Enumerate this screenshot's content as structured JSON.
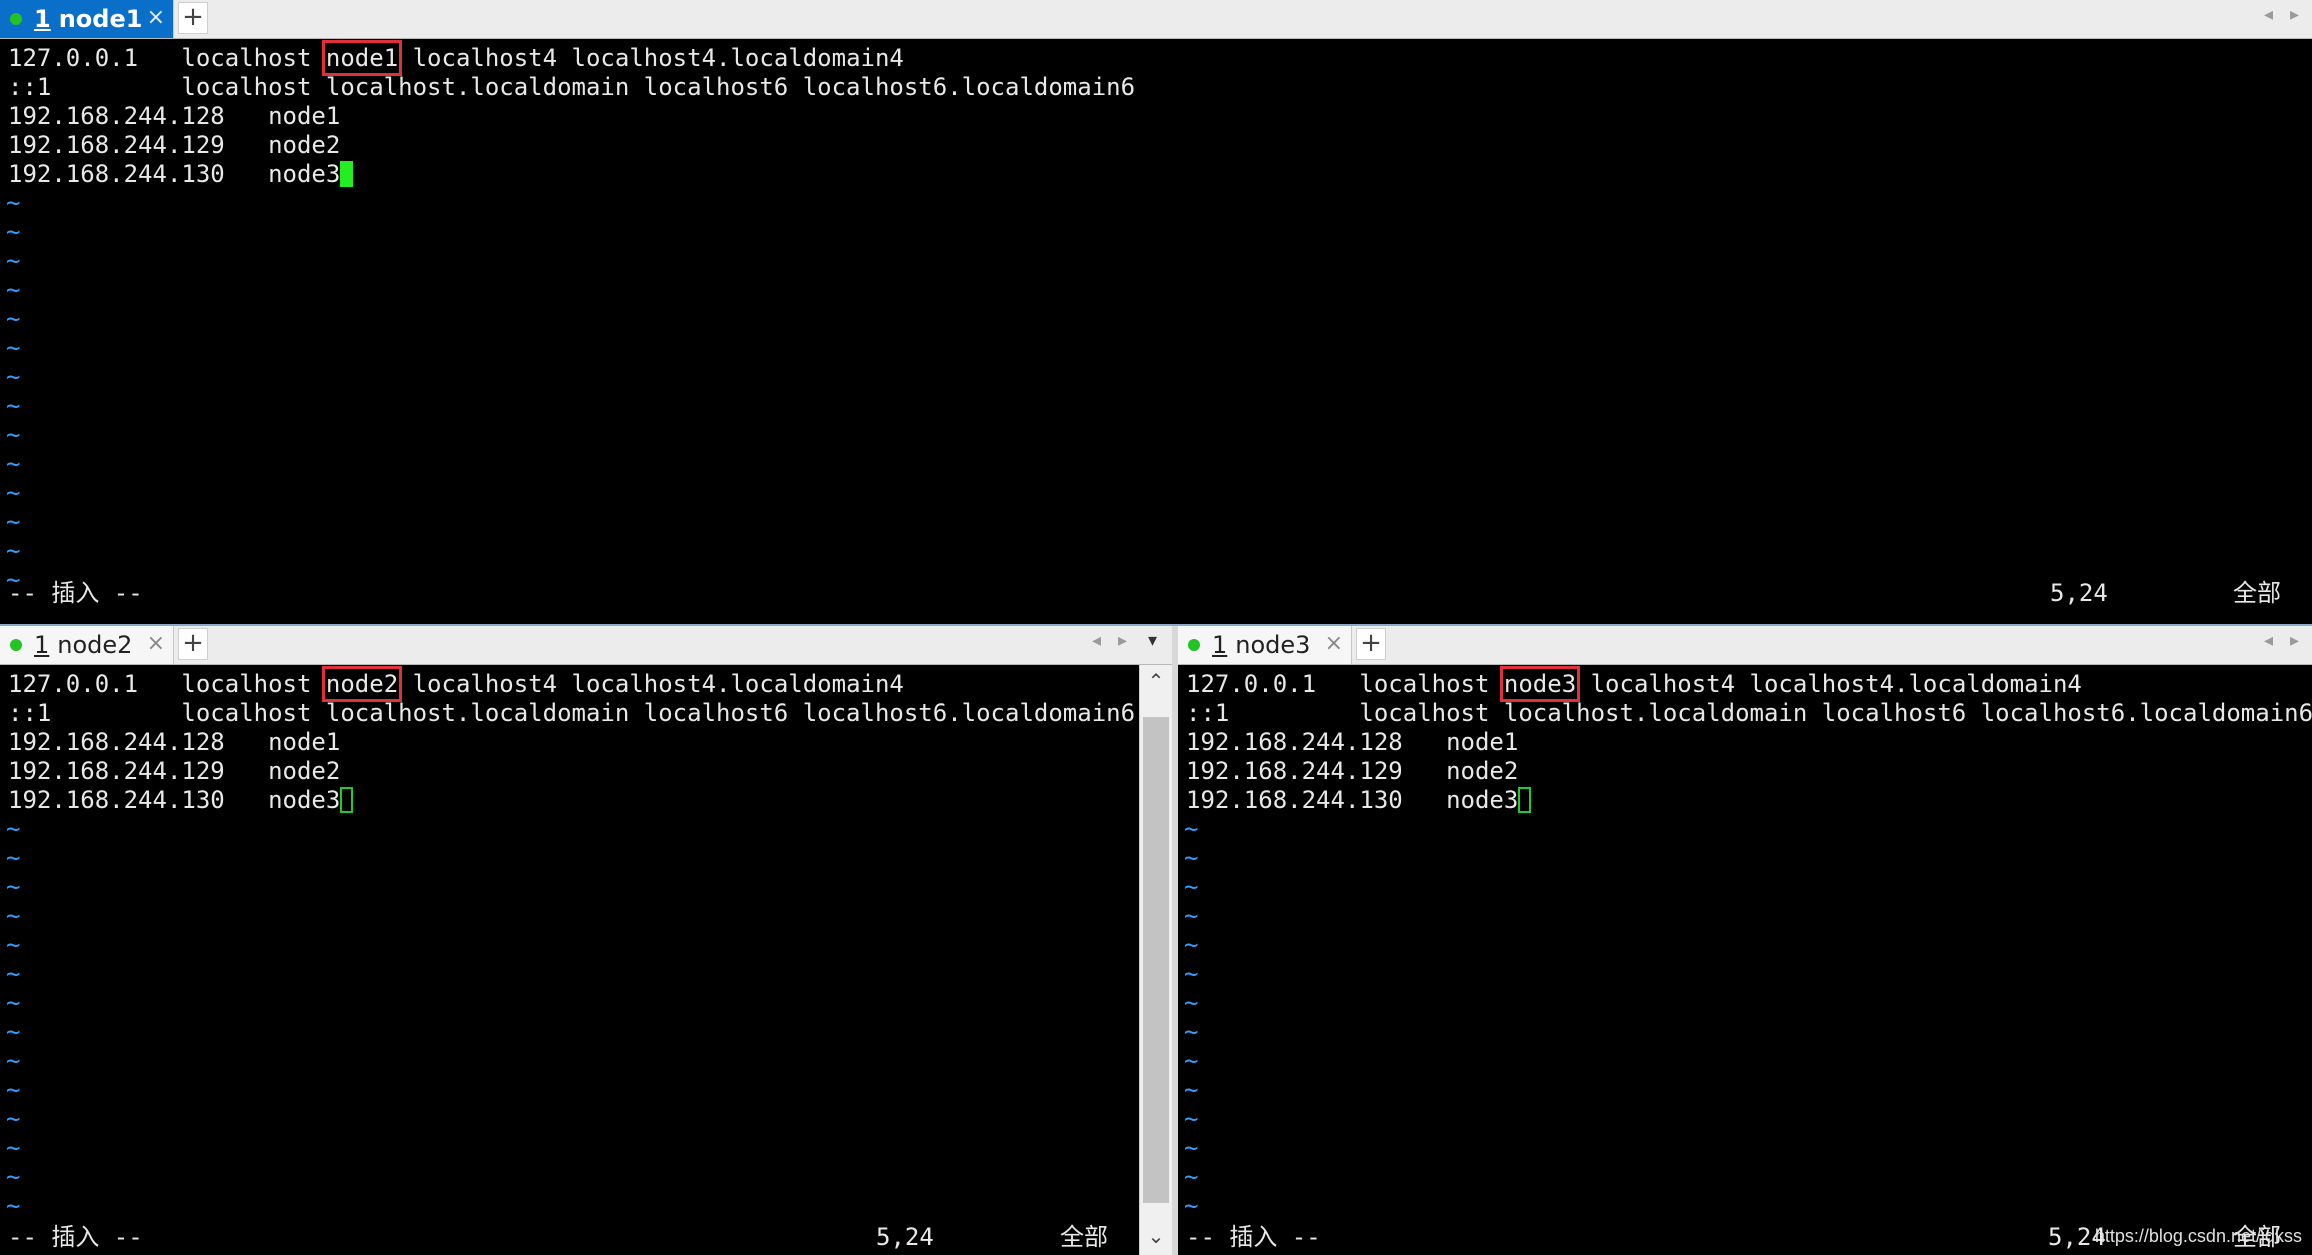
{
  "colors": {
    "tab_active": "#0a6fc9",
    "terminal_bg": "#000000",
    "tilde": "#2fa0ff",
    "highlight_box": "#e0303a",
    "cursor": "#22ee22",
    "session_dot": "#22c322"
  },
  "panes": {
    "top": {
      "tab": {
        "number": "1",
        "name": "node1",
        "close": "×",
        "new": "+"
      },
      "lines": [
        {
          "a": "127.0.0.1   localhost ",
          "hl": "node1",
          "b": " localhost4 localhost4.localdomain4"
        },
        {
          "a": "::1         localhost localhost.localdomain localhost6 localhost6.localdomain6"
        },
        {
          "a": "192.168.244.128   node1"
        },
        {
          "a": "192.168.244.129   node2"
        },
        {
          "a": "192.168.244.130   node3"
        }
      ],
      "tilde": "~",
      "mode": "-- 插入 --",
      "position": "5,24",
      "scroll": "全部"
    },
    "bottom_left": {
      "tab": {
        "number": "1",
        "name": "node2",
        "close": "×",
        "new": "+"
      },
      "lines": [
        {
          "a": "127.0.0.1   localhost ",
          "hl": "node2",
          "b": " localhost4 localhost4.localdomain4"
        },
        {
          "a": "::1         localhost localhost.localdomain localhost6 localhost6.localdomain6"
        },
        {
          "a": "192.168.244.128   node1"
        },
        {
          "a": "192.168.244.129   node2"
        },
        {
          "a": "192.168.244.130   node3"
        }
      ],
      "tilde": "~",
      "mode": "-- 插入 --",
      "position": "5,24",
      "scroll": "全部"
    },
    "bottom_right": {
      "tab": {
        "number": "1",
        "name": "node3",
        "close": "×",
        "new": "+"
      },
      "lines": [
        {
          "a": "127.0.0.1   localhost ",
          "hl": "node3",
          "b": " localhost4 localhost4.localdomain4"
        },
        {
          "a": "::1         localhost localhost.localdomain localhost6 localhost6.localdomain6"
        },
        {
          "a": "192.168.244.128   node1"
        },
        {
          "a": "192.168.244.129   node2"
        },
        {
          "a": "192.168.244.130   node3"
        }
      ],
      "tilde": "~",
      "mode": "-- 插入 --",
      "position": "5,24",
      "scroll": "全部"
    }
  },
  "watermark": "https://blog.csdn.net/jdkss"
}
